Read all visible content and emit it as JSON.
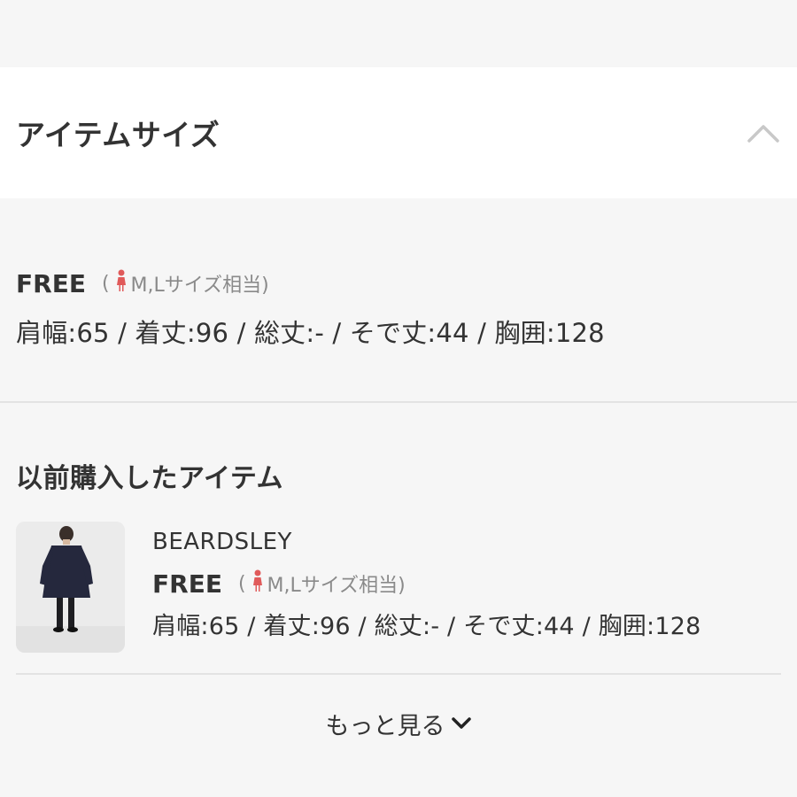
{
  "section": {
    "title": "アイテムサイズ",
    "expanded": true
  },
  "size": {
    "name": "FREE",
    "equivalent_open": "(",
    "equivalent": "M,Lサイズ相当)",
    "measurements": "肩幅:65 / 着丈:96 / 総丈:- / そで丈:44 / 胸囲:128"
  },
  "previous": {
    "title": "以前購入したアイテム",
    "items": [
      {
        "brand": "BEARDSLEY",
        "size_name": "FREE",
        "equivalent_open": "(",
        "equivalent": "M,Lサイズ相当)",
        "measurements": "肩幅:65 / 着丈:96 / 総丈:- / そで丈:44 / 胸囲:128"
      }
    ]
  },
  "more": {
    "label": "もっと見る"
  },
  "colors": {
    "accent_female": "#e05a5a",
    "muted": "#8a8a8a",
    "background": "#f6f6f6"
  }
}
